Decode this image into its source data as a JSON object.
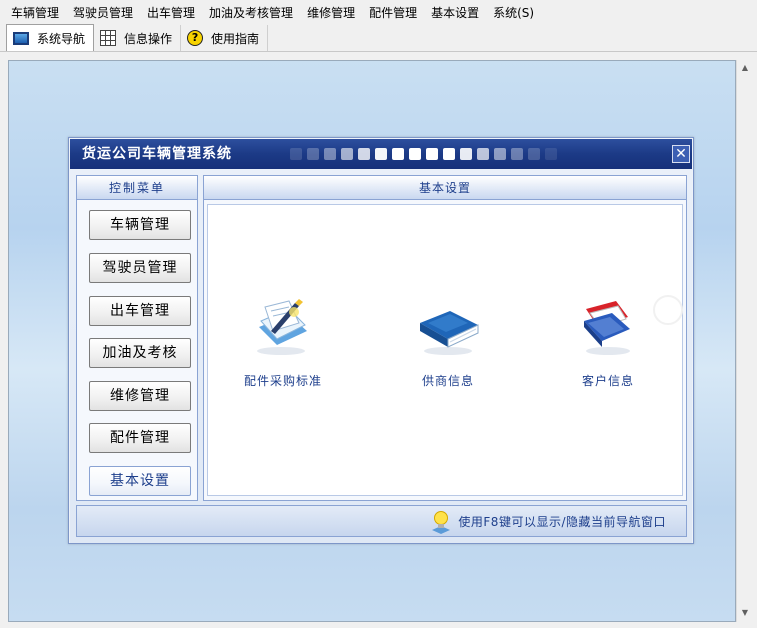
{
  "menu": [
    "车辆管理",
    "驾驶员管理",
    "出车管理",
    "加油及考核管理",
    "维修管理",
    "配件管理",
    "基本设置",
    "系统(S)"
  ],
  "toolbar": {
    "tabs": [
      {
        "label": "系统导航",
        "icon": "monitor-icon"
      },
      {
        "label": "信息操作",
        "icon": "grid-icon"
      },
      {
        "label": "使用指南",
        "icon": "help-icon"
      }
    ]
  },
  "dialog": {
    "title": "货运公司车辆管理系统",
    "left_header": "控制菜单",
    "nav_buttons": [
      "车辆管理",
      "驾驶员管理",
      "出车管理",
      "加油及考核",
      "维修管理",
      "配件管理",
      "基本设置"
    ],
    "selected_nav": "基本设置",
    "right_header": "基本设置",
    "features": [
      {
        "label": "配件采购标准",
        "icon": "document-pen-icon"
      },
      {
        "label": "供商信息",
        "icon": "blue-book-icon"
      },
      {
        "label": "客户信息",
        "icon": "red-blue-folder-icon"
      }
    ],
    "tip": "使用F8键可以显示/隐藏当前导航窗口"
  },
  "colors": {
    "title_bar": "#1c3a86",
    "accent_text": "#1e3f8c",
    "workspace_bg": "#c9dff2"
  }
}
